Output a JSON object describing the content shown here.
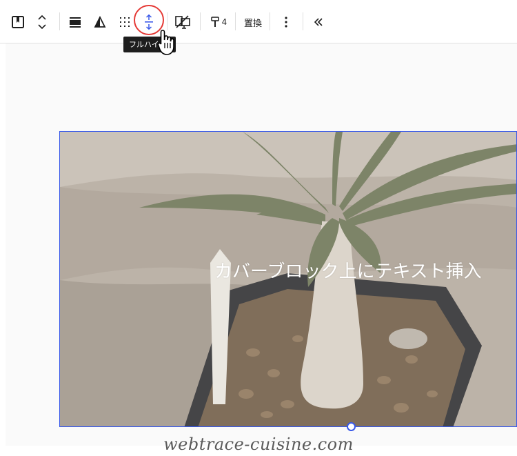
{
  "toolbar": {
    "tooltip": "フルハイ",
    "badge_count": "4",
    "replace_label": "置換",
    "items": [
      {
        "name": "block-type-icon"
      },
      {
        "name": "move-up-down-icon"
      },
      {
        "name": "align-full-icon"
      },
      {
        "name": "change-position-icon"
      },
      {
        "name": "matrix-icon"
      },
      {
        "name": "full-height-toggle-icon",
        "active": true
      },
      {
        "name": "duotone-icon"
      },
      {
        "name": "styles-icon"
      },
      {
        "name": "more-options-icon"
      },
      {
        "name": "collapse-toolbar-icon"
      }
    ],
    "active_color": "#3858e9",
    "highlight_color": "#e53935"
  },
  "cover": {
    "text": "カバーブロック上にテキスト挿入",
    "border_color": "#3858e9"
  },
  "watermark": "webtrace-cuisine.com"
}
